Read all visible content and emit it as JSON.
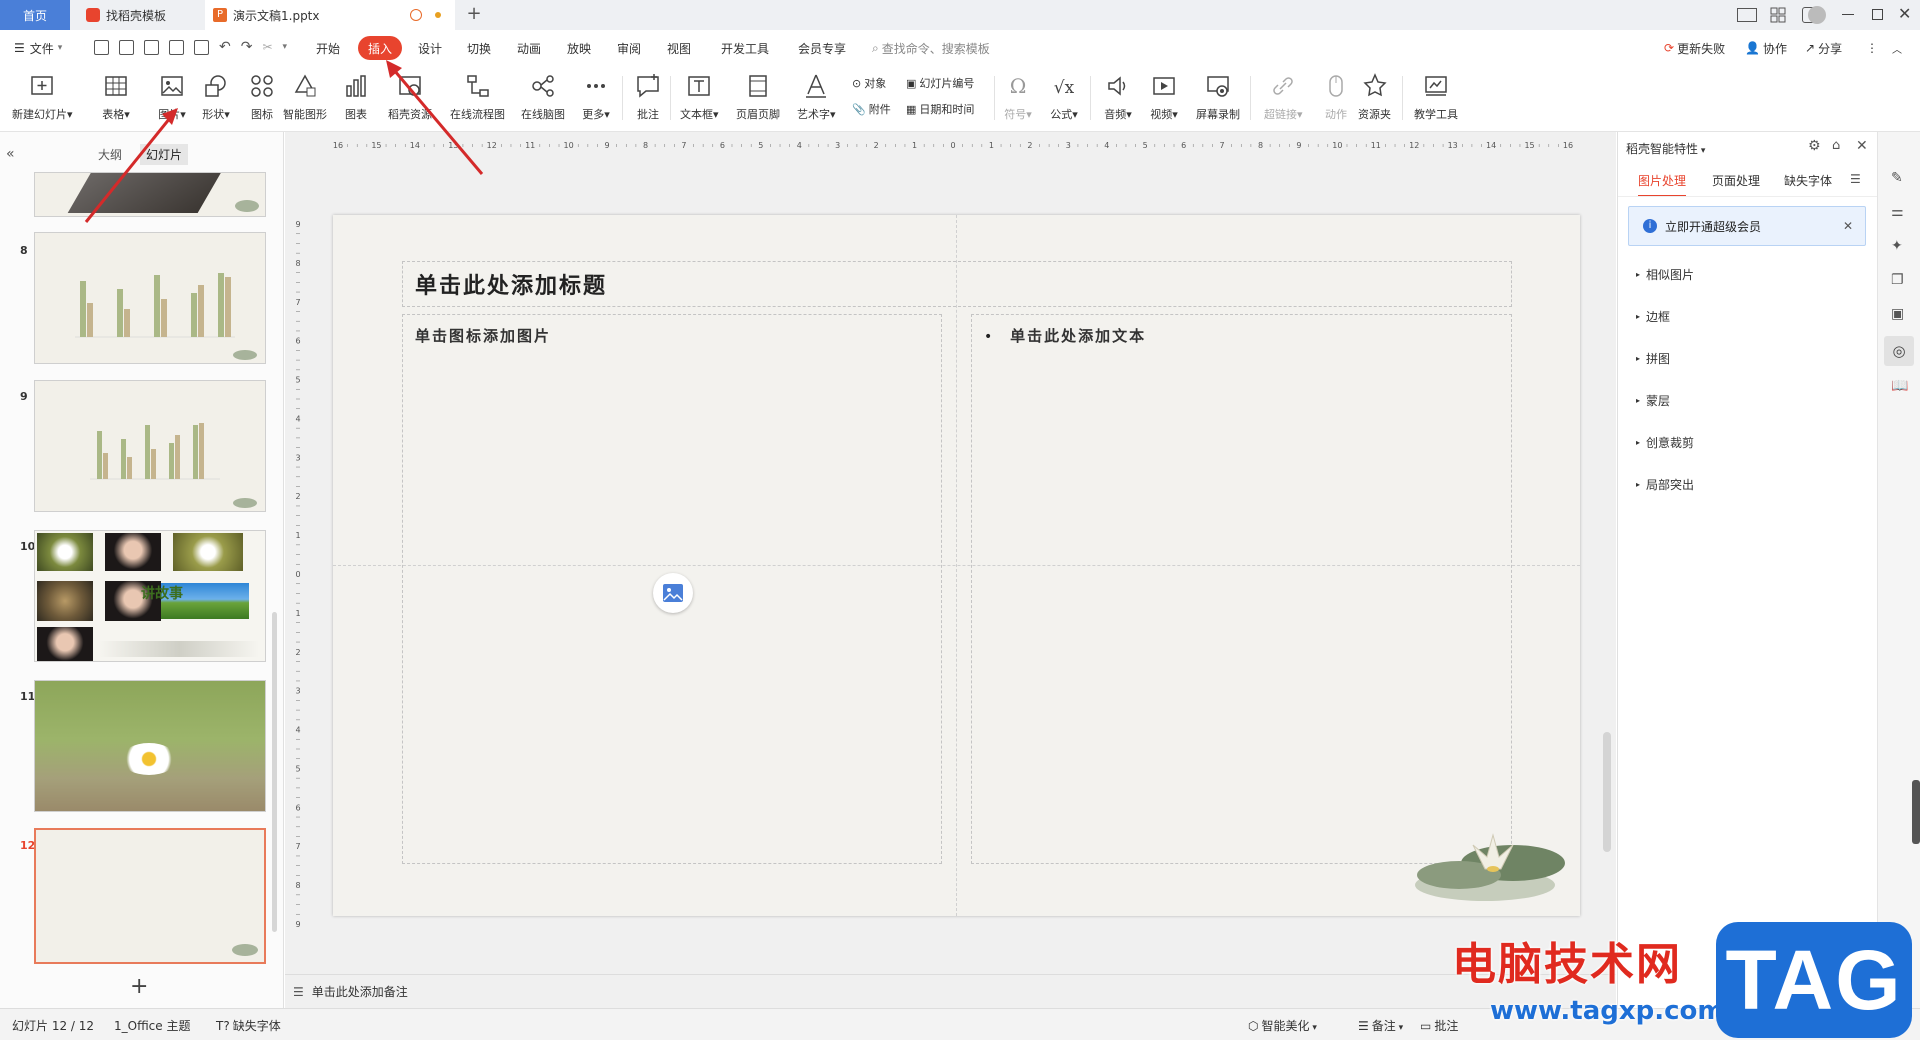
{
  "tabs": [
    {
      "label": "首页"
    },
    {
      "label": "找稻壳模板"
    },
    {
      "label": "演示文稿1.pptx"
    }
  ],
  "menu": {
    "file": "文件",
    "items": [
      "开始",
      "插入",
      "设计",
      "切换",
      "动画",
      "放映",
      "审阅",
      "视图",
      "开发工具",
      "会员专享"
    ],
    "search_placeholder": "查找命令、搜索模板",
    "update_failed": "更新失败",
    "collaborate": "协作",
    "share": "分享"
  },
  "ribbon": {
    "new_slide": "新建幻灯片",
    "table": "表格",
    "picture": "图片",
    "shape": "形状",
    "icon": "图标",
    "smart_graphic": "智能图形",
    "chart": "图表",
    "docer_resources": "稻壳资源",
    "online_flowchart": "在线流程图",
    "online_mindmap": "在线脑图",
    "more": "更多",
    "comment": "批注",
    "textbox": "文本框",
    "header_footer": "页眉页脚",
    "wordart": "艺术字",
    "object": "对象",
    "slide_number": "幻灯片编号",
    "attachment": "附件",
    "date_time": "日期和时间",
    "symbol": "符号",
    "formula": "公式",
    "audio": "音频",
    "video": "视频",
    "screen_record": "屏幕录制",
    "hyperlink": "超链接",
    "action": "动作",
    "resource_folder": "资源夹",
    "teaching_tools": "教学工具"
  },
  "left_panel": {
    "outline_tab": "大纲",
    "slides_tab": "幻灯片",
    "slides": [
      {
        "number": "8"
      },
      {
        "number": "9"
      },
      {
        "number": "10"
      },
      {
        "number": "11"
      },
      {
        "number": "12"
      }
    ],
    "thumb10_caption": "讲故事"
  },
  "ruler": {
    "h_labels": [
      "16",
      "15",
      "14",
      "13",
      "12",
      "11",
      "10",
      "9",
      "8",
      "7",
      "6",
      "5",
      "4",
      "3",
      "2",
      "1",
      "0",
      "1",
      "2",
      "3",
      "4",
      "5",
      "6",
      "7",
      "8",
      "9",
      "10",
      "11",
      "12",
      "13",
      "14",
      "15",
      "16"
    ],
    "v_labels": [
      "9",
      "8",
      "7",
      "6",
      "5",
      "4",
      "3",
      "2",
      "1",
      "0",
      "1",
      "2",
      "3",
      "4",
      "5",
      "6",
      "7",
      "8",
      "9"
    ]
  },
  "slide": {
    "title_placeholder": "单击此处添加标题",
    "picture_placeholder": "单击图标添加图片",
    "text_placeholder": "单击此处添加文本"
  },
  "notes_placeholder": "单击此处添加备注",
  "right_panel": {
    "title": "稻壳智能特性",
    "tabs": [
      "图片处理",
      "页面处理",
      "缺失字体"
    ],
    "vip_banner": "立即开通超级会员",
    "items": [
      "相似图片",
      "边框",
      "拼图",
      "蒙层",
      "创意裁剪",
      "局部突出"
    ]
  },
  "status": {
    "slide_count": "幻灯片 12 / 12",
    "theme": "1_Office 主题",
    "missing_font": "缺失字体",
    "smart_beautify": "智能美化",
    "notes": "备注",
    "comment": "批注"
  },
  "watermark": {
    "site_cn": "电脑技术网",
    "site_url": "www.tagxp.com",
    "tag": "TAG"
  },
  "colors": {
    "accent": "#e8442e",
    "arrow": "#d42a2a",
    "slide_bg": "#f3f2ee",
    "bar_green": "#aab886",
    "bar_tan": "#c5b48e",
    "wm_red": "#e02a1f",
    "wm_blue": "#1e6fd6"
  }
}
